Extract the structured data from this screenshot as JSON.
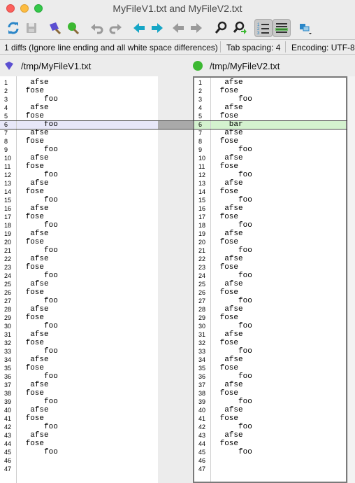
{
  "window": {
    "title": "MyFileV1.txt and MyFileV2.txt"
  },
  "toolbar": {
    "icons": [
      "refresh-icon",
      "save-icon",
      "merge-left-icon",
      "merge-right-icon",
      "undo-icon",
      "redo-icon",
      "next-diff-left-icon",
      "next-diff-right-icon",
      "prev-left-icon",
      "prev-right-icon",
      "search-icon",
      "search-next-icon",
      "line-numbers-icon",
      "show-diffs-icon",
      "view-mode-icon"
    ]
  },
  "status": {
    "diffs": "1 diffs (Ignore line ending and all white space differences)",
    "tab_spacing": "Tab spacing: 4",
    "encoding": "Encoding: UTF-8"
  },
  "left": {
    "path": "/tmp/MyFileV1.txt",
    "color": "#5b4fd1",
    "lines": [
      "  afse",
      " fose",
      "     foo",
      "  afse",
      " fose",
      "     foo",
      "  afse",
      " fose",
      "     foo",
      "  afse",
      " fose",
      "     foo",
      "  afse",
      " fose",
      "     foo",
      "  afse",
      " fose",
      "     foo",
      "  afse",
      " fose",
      "     foo",
      "  afse",
      " fose",
      "     foo",
      "  afse",
      " fose",
      "     foo",
      "  afse",
      " fose",
      "     foo",
      "  afse",
      " fose",
      "     foo",
      "  afse",
      " fose",
      "     foo",
      "  afse",
      " fose",
      "     foo",
      "  afse",
      " fose",
      "     foo",
      "  afse",
      " fose",
      "     foo",
      "",
      ""
    ]
  },
  "right": {
    "path": "/tmp/MyFileV2.txt",
    "color": "#3cb832",
    "lines": [
      "  afse",
      " fose",
      "     foo",
      "  afse",
      " fose",
      "   bar",
      "  afse",
      " fose",
      "     foo",
      "  afse",
      " fose",
      "     foo",
      "  afse",
      " fose",
      "     foo",
      "  afse",
      " fose",
      "     foo",
      "  afse",
      " fose",
      "     foo",
      "  afse",
      " fose",
      "     foo",
      "  afse",
      " fose",
      "     foo",
      "  afse",
      " fose",
      "     foo",
      "  afse",
      " fose",
      "     foo",
      "  afse",
      " fose",
      "     foo",
      "  afse",
      " fose",
      "     foo",
      "  afse",
      " fose",
      "     foo",
      "  afse",
      " fose",
      "     foo",
      "",
      ""
    ]
  }
}
